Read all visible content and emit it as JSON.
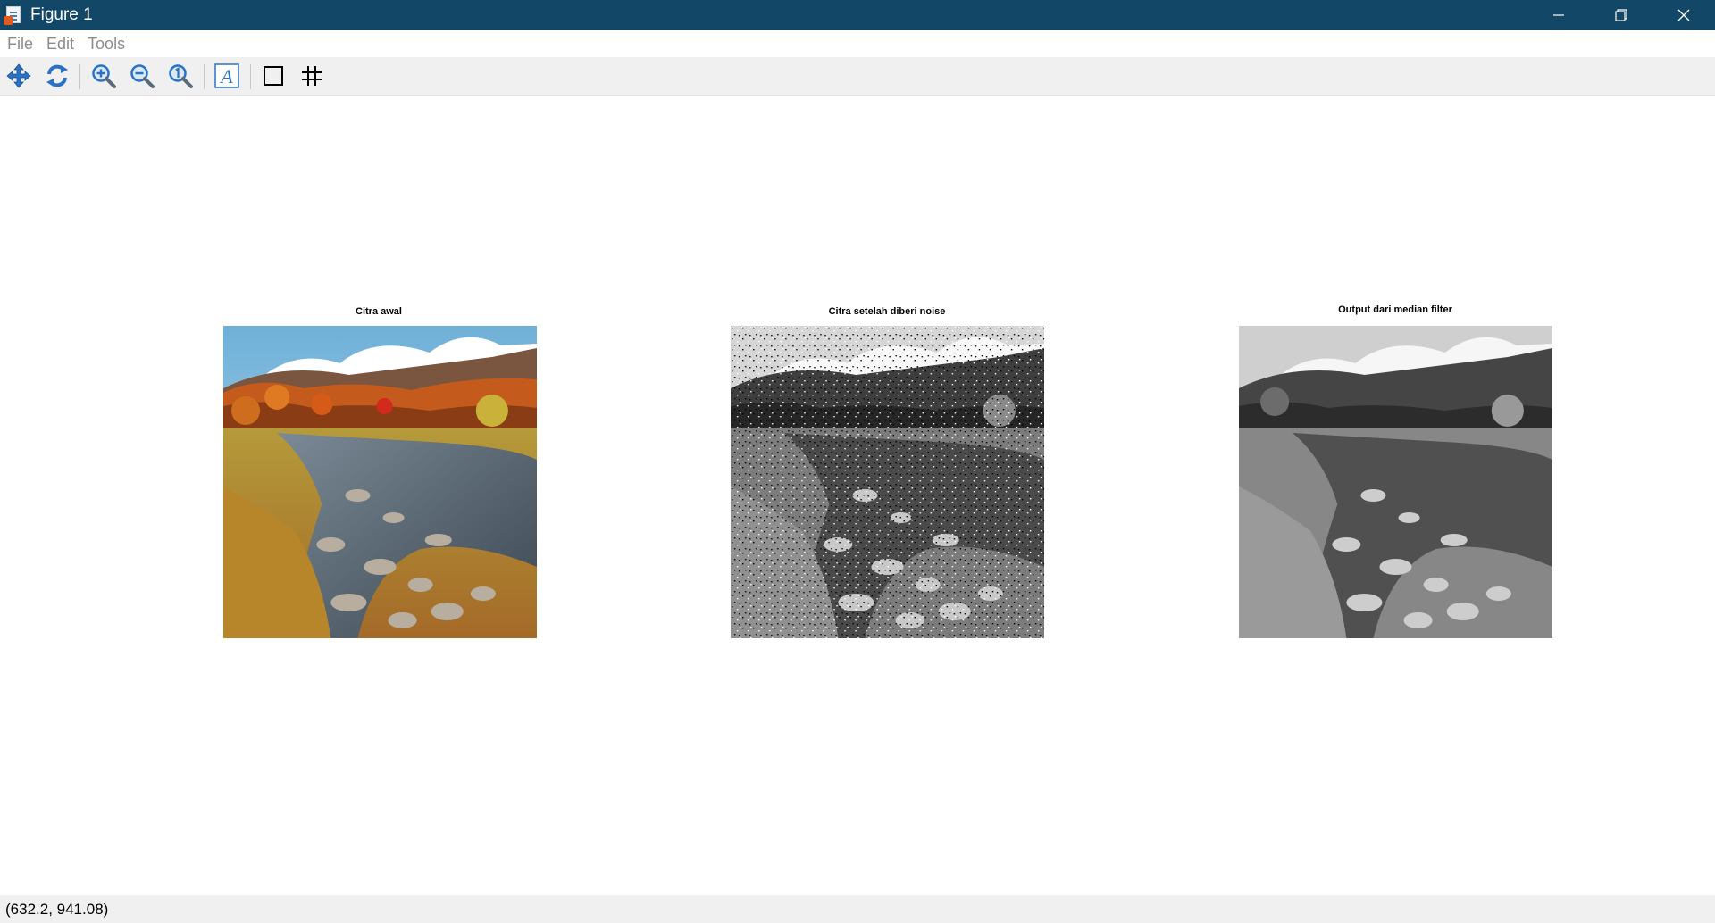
{
  "window": {
    "title": "Figure 1",
    "icon": "matlab-figure-icon"
  },
  "menu": {
    "items": [
      "File",
      "Edit",
      "Tools"
    ]
  },
  "toolbar": {
    "tools": [
      "pan-icon",
      "reset-view-icon",
      "zoom-in-icon",
      "zoom-out-icon",
      "zoom-reset-icon",
      "text-annotation-icon",
      "axes-box-icon",
      "grid-icon"
    ]
  },
  "subplots": [
    {
      "title": "Citra awal",
      "mode": "color"
    },
    {
      "title": "Citra setelah diberi noise",
      "mode": "grayscale-noise"
    },
    {
      "title": "Output dari median filter",
      "mode": "grayscale"
    }
  ],
  "status": {
    "coordinates": "(632.2, 941.08)"
  },
  "colors": {
    "titlebar": "#124767",
    "toolbar": "#f0f0f0",
    "icon_blue": "#2a72c7"
  }
}
